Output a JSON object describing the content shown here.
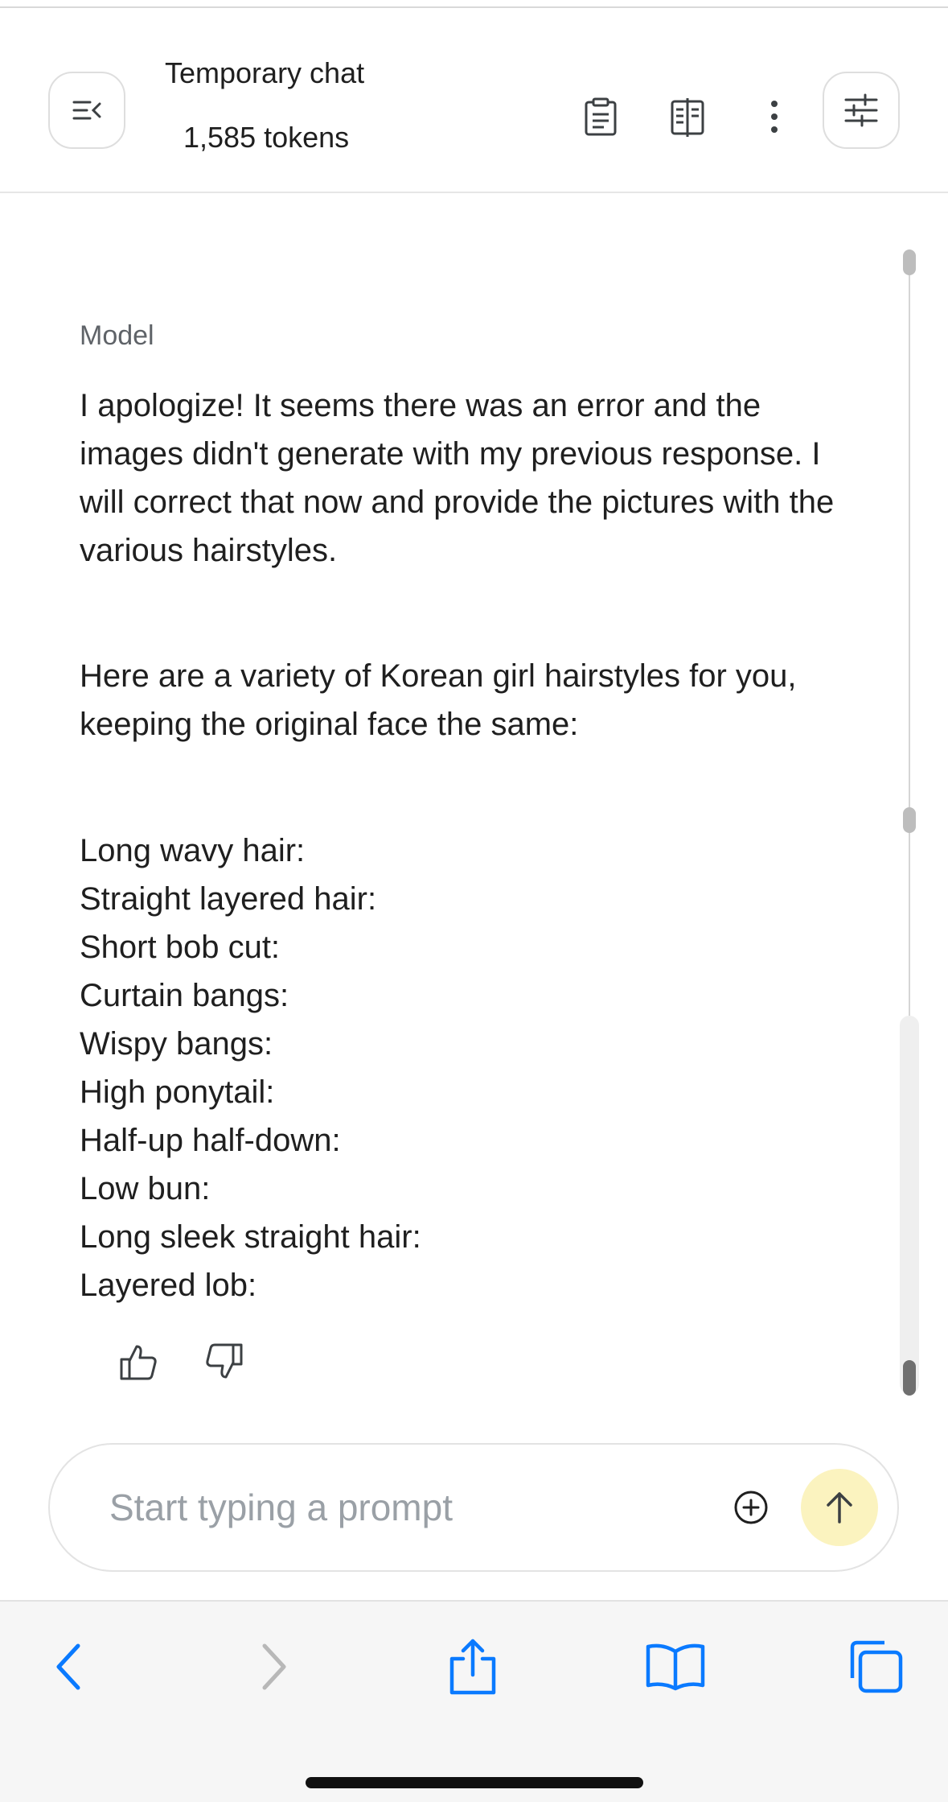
{
  "header": {
    "title": "Temporary chat",
    "token_count": "1,585 tokens"
  },
  "message": {
    "role": "Model",
    "paragraphs": [
      "I apologize! It seems there was an error and the images didn't generate with my previous response. I will correct that now and provide the pictures with the various hairstyles.",
      "Here are a variety of Korean girl hairstyles for you, keeping the original face the same:"
    ],
    "hairstyles": [
      "Long wavy hair:",
      "Straight layered hair:",
      "Short bob cut:",
      "Curtain bangs:",
      "Wispy bangs:",
      "High ponytail:",
      "Half-up half-down:",
      "Low bun:",
      "Long sleek straight hair:",
      "Layered lob:"
    ]
  },
  "prompt": {
    "placeholder": "Start typing a prompt",
    "value": ""
  },
  "icons": {
    "sidebar_toggle": "collapse-sidebar-icon",
    "copy": "clipboard-icon",
    "compare": "compare-icon",
    "more": "more-vertical-icon",
    "settings": "tune-icon",
    "like": "thumb-up-icon",
    "dislike": "thumb-down-icon",
    "add": "add-circle-icon",
    "send": "arrow-up-icon",
    "back": "chevron-left-icon",
    "forward": "chevron-right-icon",
    "share": "share-icon",
    "bookmarks": "book-icon",
    "tabs": "tabs-icon"
  },
  "colors": {
    "accent_blue": "#0a7aff",
    "send_bg": "#fbf3bf",
    "text": "#1f1f1f",
    "muted": "#5f6368"
  }
}
